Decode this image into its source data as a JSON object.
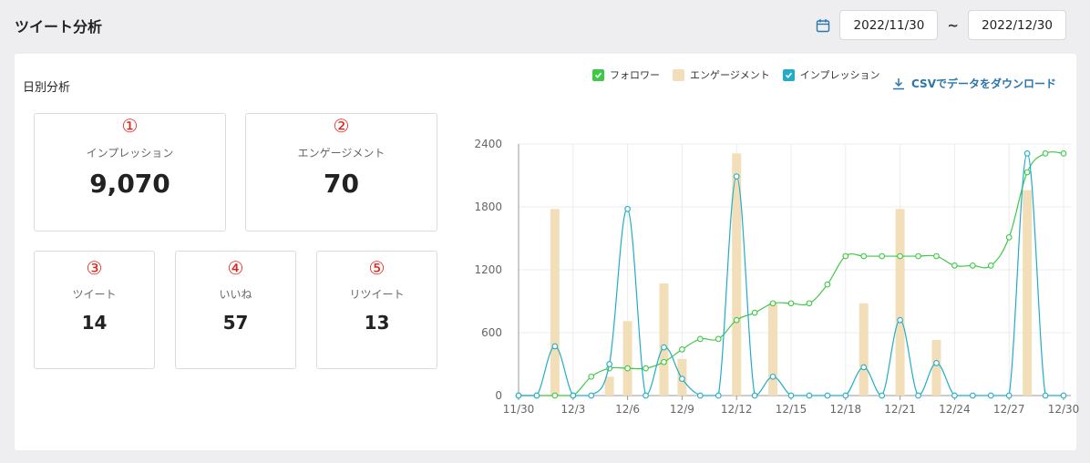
{
  "header": {
    "title": "ツイート分析",
    "date_from": "2022/11/30",
    "date_to": "2022/12/30",
    "tilde": "~"
  },
  "section": {
    "title": "日別分析",
    "csv_label": "CSVでデータをダウンロード"
  },
  "cards": [
    {
      "num": "①",
      "label": "インプレッション",
      "value": "9,070"
    },
    {
      "num": "②",
      "label": "エンゲージメント",
      "value": "70"
    },
    {
      "num": "③",
      "label": "ツイート",
      "value": "14"
    },
    {
      "num": "④",
      "label": "いいね",
      "value": "57"
    },
    {
      "num": "⑤",
      "label": "リツイート",
      "value": "13"
    }
  ],
  "colors": {
    "follower": "#3ec846",
    "engagement": "#f2dfb9",
    "impression": "#21adc7",
    "accent": "#2a76ad",
    "circled_numbers": "#e0241b"
  },
  "chart_data": {
    "type": "bar+line",
    "legend": [
      "フォロワー",
      "エンゲージメント",
      "インプレッション"
    ],
    "legend_position": "top",
    "x": [
      "11/30",
      "12/1",
      "12/2",
      "12/3",
      "12/4",
      "12/5",
      "12/6",
      "12/7",
      "12/8",
      "12/9",
      "12/10",
      "12/11",
      "12/12",
      "12/13",
      "12/14",
      "12/15",
      "12/16",
      "12/17",
      "12/18",
      "12/19",
      "12/20",
      "12/21",
      "12/22",
      "12/23",
      "12/24",
      "12/25",
      "12/26",
      "12/27",
      "12/28",
      "12/29",
      "12/30"
    ],
    "x_tick_labels": [
      "11/30",
      "12/3",
      "12/6",
      "12/9",
      "12/12",
      "12/15",
      "12/18",
      "12/21",
      "12/24",
      "12/27",
      "12/30"
    ],
    "x_tick_indices": [
      0,
      3,
      6,
      9,
      12,
      15,
      18,
      21,
      24,
      27,
      30
    ],
    "y_ticks": [
      0,
      600,
      1200,
      1800,
      2400
    ],
    "ylim": [
      0,
      2400
    ],
    "grid": true,
    "series": [
      {
        "name": "フォロワー",
        "type": "line",
        "values": [
          0,
          0,
          0,
          0,
          180,
          260,
          260,
          260,
          320,
          440,
          540,
          540,
          720,
          790,
          880,
          880,
          880,
          1060,
          1330,
          1330,
          1330,
          1330,
          1330,
          1330,
          1240,
          1240,
          1240,
          1510,
          2130,
          2310,
          2310
        ]
      },
      {
        "name": "エンゲージメント",
        "type": "bar",
        "values": [
          0,
          0,
          1780,
          0,
          0,
          180,
          710,
          0,
          1070,
          350,
          0,
          0,
          2310,
          0,
          880,
          0,
          0,
          0,
          0,
          880,
          0,
          1780,
          0,
          530,
          0,
          0,
          0,
          0,
          1960,
          0,
          0
        ]
      },
      {
        "name": "インプレッション",
        "type": "line",
        "values": [
          0,
          0,
          470,
          0,
          0,
          300,
          1780,
          0,
          460,
          160,
          0,
          0,
          2090,
          0,
          180,
          0,
          0,
          0,
          0,
          270,
          0,
          720,
          0,
          310,
          0,
          0,
          0,
          0,
          2310,
          0,
          0
        ]
      }
    ]
  }
}
